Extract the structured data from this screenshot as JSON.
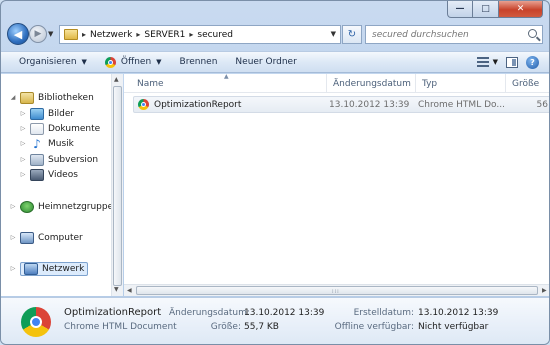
{
  "window": {
    "minimize_glyph": "—",
    "maximize_glyph": "□",
    "close_glyph": "✕"
  },
  "nav": {
    "back_glyph": "◀",
    "forward_glyph": "▶",
    "dropdown_glyph": "▼",
    "breadcrumb": [
      "Netzwerk",
      "SERVER1",
      "secured"
    ],
    "crumb_separator": "▸",
    "refresh_glyph": "↻",
    "search_placeholder": "secured durchsuchen"
  },
  "toolbar": {
    "organize_label": "Organisieren",
    "open_label": "Öffnen",
    "burn_label": "Brennen",
    "new_folder_label": "Neuer Ordner",
    "dropdown_glyph": "▼",
    "help_glyph": "?"
  },
  "navpane": {
    "twisty_open": "◢",
    "twisty_closed": "▷",
    "libraries_label": "Bibliotheken",
    "library_items": [
      "Bilder",
      "Dokumente",
      "Musik",
      "Subversion",
      "Videos"
    ],
    "homegroup_label": "Heimnetzgruppe",
    "computer_label": "Computer",
    "network_label": "Netzwerk",
    "music_glyph": "♪"
  },
  "columns": {
    "name": "Name",
    "modified": "Änderungsdatum",
    "type": "Typ",
    "size": "Größe",
    "sort_glyph": "▲"
  },
  "files": [
    {
      "name": "OptimizationReport",
      "modified": "13.10.2012 13:39",
      "type": "Chrome HTML Do...",
      "size": "56"
    }
  ],
  "details": {
    "name": "OptimizationReport",
    "type": "Chrome HTML Document",
    "modified_label": "Änderungsdatum:",
    "modified_value": "13.10.2012 13:39",
    "size_label": "Größe:",
    "size_value": "55,7 KB",
    "created_label": "Erstelldatum:",
    "created_value": "13.10.2012 13:39",
    "offline_label": "Offline verfügbar:",
    "offline_value": "Nicht verfügbar"
  },
  "scroll": {
    "up": "▲",
    "down": "▼",
    "left": "◀",
    "right": "▶",
    "grip": "⁞⁞⁞"
  }
}
